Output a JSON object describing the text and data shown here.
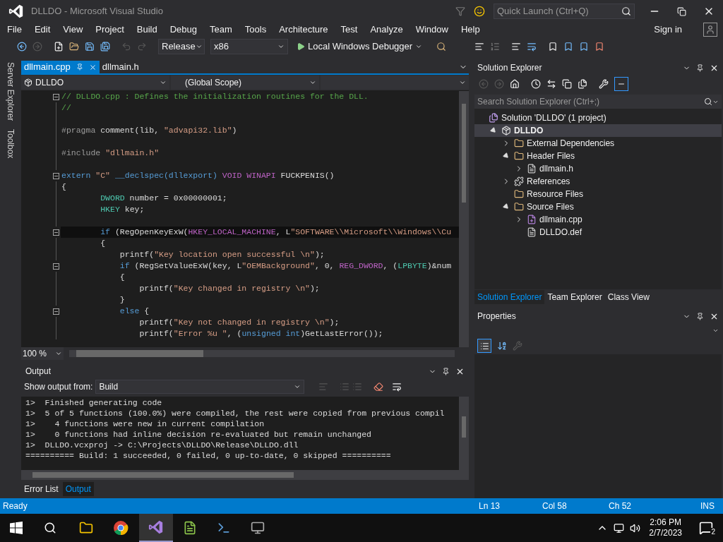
{
  "window": {
    "title": "DLLDO - Microsoft Visual Studio"
  },
  "quick_launch": {
    "placeholder": "Quick Launch (Ctrl+Q)"
  },
  "menu": [
    "File",
    "Edit",
    "View",
    "Project",
    "Build",
    "Debug",
    "Team",
    "Tools",
    "Architecture",
    "Test",
    "Analyze",
    "Window",
    "Help"
  ],
  "account": {
    "label": "Sign in"
  },
  "toolbar": {
    "configuration": "Release",
    "platform": "x86",
    "debugger": "Local Windows Debugger"
  },
  "side_tabs": [
    "Server Explorer",
    "Toolbox"
  ],
  "editor": {
    "tabs": [
      {
        "label": "dllmain.cpp",
        "selected": true
      },
      {
        "label": "dllmain.h",
        "selected": false
      }
    ],
    "project": "DLLDO",
    "scope": "(Global Scope)",
    "zoom": "100 %",
    "lines": [
      {
        "kind": "code",
        "fold": true,
        "current": false,
        "tokens": [
          {
            "kind": "comment",
            "text": "// DLLDO.cpp : Defines the initialization routines for the DLL."
          }
        ]
      },
      {
        "kind": "code",
        "fold": false,
        "current": false,
        "tokens": [
          {
            "kind": "comment",
            "text": "//"
          }
        ]
      },
      {
        "kind": "blank"
      },
      {
        "kind": "code",
        "fold": false,
        "current": false,
        "tokens": [
          {
            "kind": "preprocessor",
            "text": "#pragma"
          },
          {
            "kind": "plain",
            "text": " comment(lib, "
          },
          {
            "kind": "string",
            "text": "\"advapi32.lib\""
          },
          {
            "kind": "plain",
            "text": ")"
          }
        ]
      },
      {
        "kind": "blank"
      },
      {
        "kind": "code",
        "fold": false,
        "current": false,
        "tokens": [
          {
            "kind": "preprocessor",
            "text": "#include "
          },
          {
            "kind": "string",
            "text": "\"dllmain.h\""
          }
        ]
      },
      {
        "kind": "blank"
      },
      {
        "kind": "code",
        "fold": true,
        "current": false,
        "tokens": [
          {
            "kind": "keyword",
            "text": "extern "
          },
          {
            "kind": "string",
            "text": "\"C\" "
          },
          {
            "kind": "keyword",
            "text": "__declspec(dllexport) "
          },
          {
            "kind": "macro",
            "text": "VOID "
          },
          {
            "kind": "macro",
            "text": "WINAPI"
          },
          {
            "kind": "plain",
            "text": " FUCKPENIS()"
          }
        ]
      },
      {
        "kind": "code",
        "fold": false,
        "current": false,
        "tokens": [
          {
            "kind": "plain",
            "text": "{"
          }
        ]
      },
      {
        "kind": "code",
        "fold": false,
        "current": false,
        "tokens": [
          {
            "kind": "type",
            "text": "        DWORD"
          },
          {
            "kind": "plain",
            "text": " number = 0x00000001;"
          }
        ]
      },
      {
        "kind": "code",
        "fold": false,
        "current": false,
        "tokens": [
          {
            "kind": "type",
            "text": "        HKEY"
          },
          {
            "kind": "plain",
            "text": " key;"
          }
        ]
      },
      {
        "kind": "blank"
      },
      {
        "kind": "code",
        "fold": true,
        "current": true,
        "tokens": [
          {
            "kind": "keyword",
            "text": "        if"
          },
          {
            "kind": "plain",
            "text": " (RegOpenKeyExW("
          },
          {
            "kind": "macro",
            "text": "HKEY_LOCAL_MACHINE"
          },
          {
            "kind": "plain",
            "text": ", L"
          },
          {
            "kind": "string",
            "text": "\"SOFTWARE\\\\Microsoft\\\\Windows\\\\Cu"
          }
        ]
      },
      {
        "kind": "code",
        "fold": false,
        "current": false,
        "tokens": [
          {
            "kind": "plain",
            "text": "        {"
          }
        ]
      },
      {
        "kind": "code",
        "fold": false,
        "current": false,
        "tokens": [
          {
            "kind": "plain",
            "text": "            printf("
          },
          {
            "kind": "string",
            "text": "\"Key location open successful \\n\""
          },
          {
            "kind": "plain",
            "text": ");"
          }
        ]
      },
      {
        "kind": "code",
        "fold": true,
        "current": false,
        "tokens": [
          {
            "kind": "keyword",
            "text": "            if"
          },
          {
            "kind": "plain",
            "text": " (RegSetValueExW(key, L"
          },
          {
            "kind": "string",
            "text": "\"OEMBackground\""
          },
          {
            "kind": "plain",
            "text": ", 0, "
          },
          {
            "kind": "macro",
            "text": "REG_DWORD"
          },
          {
            "kind": "plain",
            "text": ", ("
          },
          {
            "kind": "type",
            "text": "LPBYTE"
          },
          {
            "kind": "plain",
            "text": ")&num"
          }
        ]
      },
      {
        "kind": "code",
        "fold": false,
        "current": false,
        "tokens": [
          {
            "kind": "plain",
            "text": "            {"
          }
        ]
      },
      {
        "kind": "code",
        "fold": false,
        "current": false,
        "tokens": [
          {
            "kind": "plain",
            "text": "                printf("
          },
          {
            "kind": "string",
            "text": "\"Key changed in registry \\n\""
          },
          {
            "kind": "plain",
            "text": ");"
          }
        ]
      },
      {
        "kind": "code",
        "fold": false,
        "current": false,
        "tokens": [
          {
            "kind": "plain",
            "text": "            }"
          }
        ]
      },
      {
        "kind": "code",
        "fold": true,
        "current": false,
        "tokens": [
          {
            "kind": "keyword",
            "text": "            else"
          },
          {
            "kind": "plain",
            "text": " {"
          }
        ]
      },
      {
        "kind": "code",
        "fold": false,
        "current": false,
        "tokens": [
          {
            "kind": "plain",
            "text": "                printf("
          },
          {
            "kind": "string",
            "text": "\"Key not changed in registry \\n\""
          },
          {
            "kind": "plain",
            "text": ");"
          }
        ]
      },
      {
        "kind": "code",
        "fold": false,
        "current": false,
        "tokens": [
          {
            "kind": "plain",
            "text": "                printf("
          },
          {
            "kind": "string",
            "text": "\"Error %u \""
          },
          {
            "kind": "plain",
            "text": ", ("
          },
          {
            "kind": "keyword",
            "text": "unsigned int"
          },
          {
            "kind": "plain",
            "text": ")GetLastError());"
          }
        ]
      }
    ]
  },
  "output": {
    "title": "Output",
    "source_label": "Show output from:",
    "source": "Build",
    "lines": [
      "1>  Finished generating code",
      "1>  5 of 5 functions (100.0%) were compiled, the rest were copied from previous compil",
      "1>    4 functions were new in current compilation",
      "1>    0 functions had inline decision re-evaluated but remain unchanged",
      "1>  DLLDO.vcxproj -> C:\\Projects\\DLLDO\\Release\\DLLDO.dll",
      "========== Build: 1 succeeded, 0 failed, 0 up-to-date, 0 skipped =========="
    ]
  },
  "bottom_tabs": [
    {
      "label": "Error List",
      "selected": false
    },
    {
      "label": "Output",
      "selected": true
    }
  ],
  "solution_explorer": {
    "title": "Solution Explorer",
    "search_placeholder": "Search Solution Explorer (Ctrl+;)",
    "tree": [
      {
        "label": "Solution 'DLLDO' (1 project)",
        "kind": "solution",
        "selected": false,
        "children": [
          {
            "label": "DLLDO",
            "kind": "project",
            "selected": true,
            "expanded": true,
            "children": [
              {
                "label": "External Dependencies",
                "kind": "external",
                "selected": false,
                "expanded": false
              },
              {
                "label": "Header Files",
                "kind": "filter",
                "selected": false,
                "expanded": true,
                "children": [
                  {
                    "label": "dllmain.h",
                    "kind": "header",
                    "selected": false,
                    "expanded": false
                  }
                ]
              },
              {
                "label": "References",
                "kind": "references",
                "selected": false,
                "expanded": false
              },
              {
                "label": "Resource Files",
                "kind": "folder",
                "selected": false
              },
              {
                "label": "Source Files",
                "kind": "filter",
                "selected": false,
                "expanded": true,
                "children": [
                  {
                    "label": "dllmain.cpp",
                    "kind": "cpp",
                    "selected": false,
                    "expanded": false
                  },
                  {
                    "label": "DLLDO.def",
                    "kind": "def",
                    "selected": false
                  }
                ]
              }
            ]
          }
        ]
      }
    ]
  },
  "panel_tabs": [
    {
      "label": "Solution Explorer",
      "selected": true
    },
    {
      "label": "Team Explorer",
      "selected": false
    },
    {
      "label": "Class View",
      "selected": false
    }
  ],
  "properties": {
    "title": "Properties"
  },
  "status_bar": {
    "text": "Ready",
    "line": "Ln 13",
    "column": "Col 58",
    "char": "Ch 52",
    "mode": "INS"
  },
  "taskbar": {
    "time": "2:06 PM",
    "date": "2/7/2023",
    "notifications": "2"
  }
}
